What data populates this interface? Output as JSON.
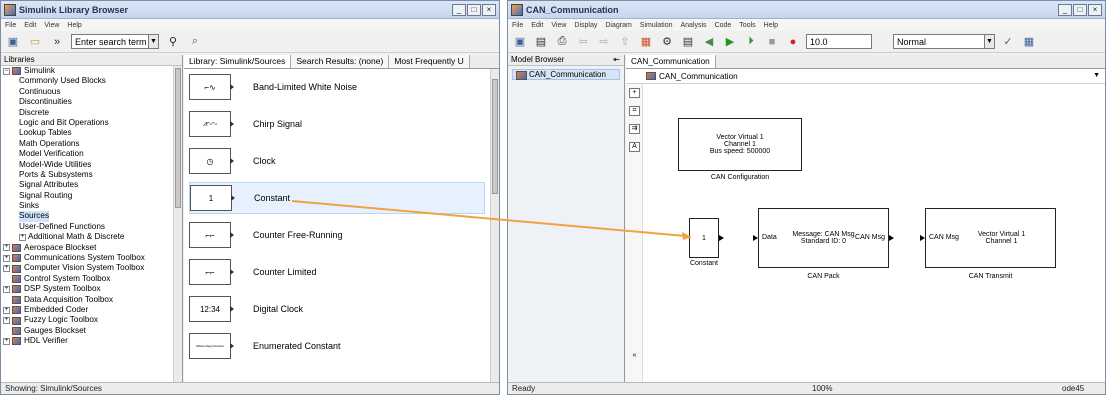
{
  "library": {
    "title": "Simulink Library Browser",
    "menu": [
      "File",
      "Edit",
      "View",
      "Help"
    ],
    "search_value": "Enter search term",
    "panel_title": "Libraries",
    "tree": [
      {
        "label": "Simulink",
        "level": 0,
        "expander": "−"
      },
      {
        "label": "Commonly Used Blocks",
        "level": 1
      },
      {
        "label": "Continuous",
        "level": 1
      },
      {
        "label": "Discontinuities",
        "level": 1
      },
      {
        "label": "Discrete",
        "level": 1
      },
      {
        "label": "Logic and Bit Operations",
        "level": 1
      },
      {
        "label": "Lookup Tables",
        "level": 1
      },
      {
        "label": "Math Operations",
        "level": 1
      },
      {
        "label": "Model Verification",
        "level": 1
      },
      {
        "label": "Model-Wide Utilities",
        "level": 1
      },
      {
        "label": "Ports & Subsystems",
        "level": 1
      },
      {
        "label": "Signal Attributes",
        "level": 1
      },
      {
        "label": "Signal Routing",
        "level": 1
      },
      {
        "label": "Sinks",
        "level": 1
      },
      {
        "label": "Sources",
        "level": 1,
        "selected": true
      },
      {
        "label": "User-Defined Functions",
        "level": 1
      },
      {
        "label": "Additional Math & Discrete",
        "level": 1,
        "expander": "+"
      },
      {
        "label": "Aerospace Blockset",
        "level": 0,
        "expander": "+"
      },
      {
        "label": "Communications System Toolbox",
        "level": 0,
        "expander": "+"
      },
      {
        "label": "Computer Vision System Toolbox",
        "level": 0,
        "expander": "+"
      },
      {
        "label": "Control System Toolbox",
        "level": 0
      },
      {
        "label": "DSP System Toolbox",
        "level": 0,
        "expander": "+"
      },
      {
        "label": "Data Acquisition Toolbox",
        "level": 0
      },
      {
        "label": "Embedded Coder",
        "level": 0,
        "expander": "+"
      },
      {
        "label": "Fuzzy Logic Toolbox",
        "level": 0,
        "expander": "+"
      },
      {
        "label": "Gauges Blockset",
        "level": 0
      },
      {
        "label": "HDL Verifier",
        "level": 0,
        "expander": "+"
      }
    ],
    "tabs": [
      "Library: Simulink/Sources",
      "Search Results: (none)",
      "Most Frequently U"
    ],
    "blocks": [
      {
        "name": "Band-Limited White Noise",
        "glyph": "⌐∿"
      },
      {
        "name": "Chirp Signal",
        "glyph": "⩘∿∿"
      },
      {
        "name": "Clock",
        "glyph": "◷"
      },
      {
        "name": "Constant",
        "glyph": "1",
        "highlight": true
      },
      {
        "name": "Counter Free-Running",
        "glyph": "⌐⌐"
      },
      {
        "name": "Counter Limited",
        "glyph": "⌐⌐"
      },
      {
        "name": "Digital Clock",
        "glyph": "12:34"
      },
      {
        "name": "Enumerated Constant",
        "glyph": "SlDemoSign.Positive"
      }
    ],
    "status": "Showing: Simulink/Sources"
  },
  "model": {
    "title": "CAN_Communication",
    "menu": [
      "File",
      "Edit",
      "View",
      "Display",
      "Diagram",
      "Simulation",
      "Analysis",
      "Code",
      "Tools",
      "Help"
    ],
    "stop_time": "10.0",
    "sim_mode": "Normal",
    "browser_title": "Model Browser",
    "browser_item": "CAN_Communication",
    "tab": "CAN_Communication",
    "address": "CAN_Communication",
    "blocks": {
      "can_config": {
        "lines": [
          "Vector Virtual 1",
          "Channel 1",
          "Bus speed: 500000"
        ],
        "label": "CAN Configuration"
      },
      "constant": {
        "value": "1",
        "label": "Constant"
      },
      "can_pack": {
        "lines": [
          "Message: CAN Msg",
          "Standard ID: 0"
        ],
        "in_port": "Data",
        "out_port": "CAN Msg",
        "label": "CAN Pack"
      },
      "can_transmit": {
        "lines": [
          "Vector Virtual 1",
          "Channel 1"
        ],
        "in_port": "CAN Msg",
        "label": "CAN Transmit"
      }
    },
    "status_left": "Ready",
    "status_mid": "100%",
    "status_right": "ode45"
  }
}
